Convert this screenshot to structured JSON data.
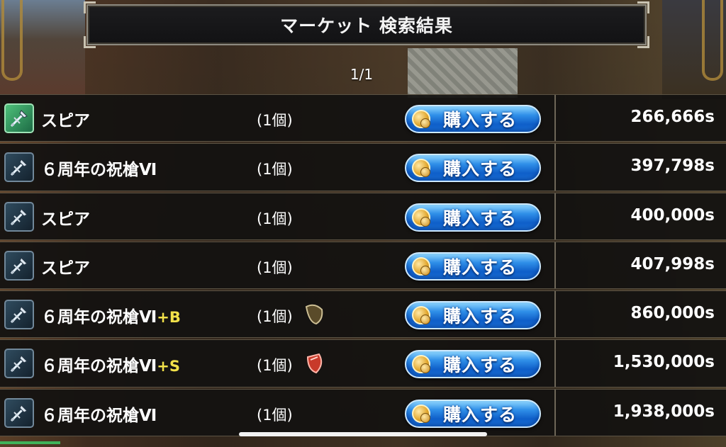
{
  "header": {
    "title": "マーケット 検索結果"
  },
  "pagination": {
    "label": "1/1"
  },
  "buy_label": "購入する",
  "listings": [
    {
      "name": "スピア",
      "suffix": "",
      "qty": "(1個)",
      "price": "266,666s",
      "icon": "spear-icon",
      "gem": ""
    },
    {
      "name": "６周年の祝槍Ⅵ",
      "suffix": "",
      "qty": "(1個)",
      "price": "397,798s",
      "icon": "spear-icon",
      "gem": ""
    },
    {
      "name": "スピア",
      "suffix": "",
      "qty": "(1個)",
      "price": "400,000s",
      "icon": "spear-icon",
      "gem": ""
    },
    {
      "name": "スピア",
      "suffix": "",
      "qty": "(1個)",
      "price": "407,998s",
      "icon": "spear-icon",
      "gem": ""
    },
    {
      "name": "６周年の祝槍Ⅵ",
      "suffix": "+B",
      "qty": "(1個)",
      "price": "860,000s",
      "icon": "spear-icon",
      "gem": "brown-gem-icon"
    },
    {
      "name": "６周年の祝槍Ⅵ",
      "suffix": "+S",
      "qty": "(1個)",
      "price": "1,530,000s",
      "icon": "spear-icon",
      "gem": "red-gem-icon"
    },
    {
      "name": "６周年の祝槍Ⅵ",
      "suffix": "",
      "qty": "(1個)",
      "price": "1,938,000s",
      "icon": "spear-icon",
      "gem": ""
    }
  ],
  "colors": {
    "button_blue": "#2f8fe8",
    "suffix_yellow": "#f2e14a",
    "row_bg": "#121110"
  }
}
